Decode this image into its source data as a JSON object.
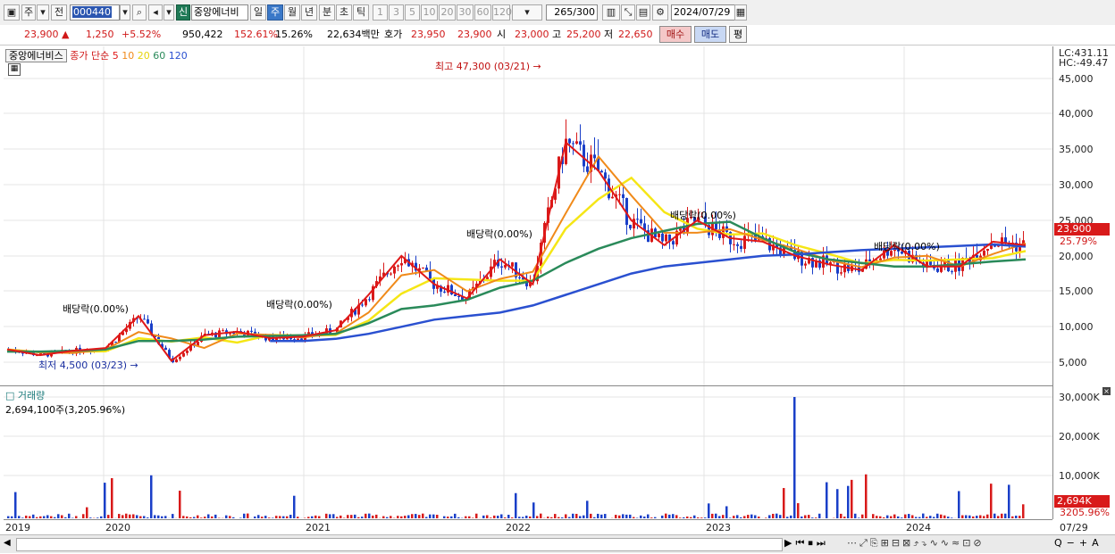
{
  "toolbar": {
    "period_type": "주",
    "prev_label": "전",
    "stock_code": "000440",
    "new_badge": "신",
    "stock_name": "중앙에너비",
    "periods": [
      "일",
      "주",
      "월",
      "년",
      "분",
      "초",
      "틱"
    ],
    "selected_period": "주",
    "minute_steps": [
      "1",
      "3",
      "5",
      "10",
      "20",
      "30",
      "60",
      "120"
    ],
    "count": "265",
    "count_total": "/300",
    "date": "2024/07/29"
  },
  "quote": {
    "price": "23,900",
    "change_arrow": "▲",
    "change": "1,250",
    "change_pct": "+5.52%",
    "volume": "950,422",
    "vol_ratio": "152.61%",
    "turnover": "15.26%",
    "amount": "22,634백만",
    "bid_ask_label": "호가",
    "ask": "23,950",
    "bid": "23,900",
    "open_label": "시",
    "open": "23,000",
    "high_label": "고",
    "high": "25,200",
    "low_label": "저",
    "low": "22,650",
    "buy_label": "매수",
    "sell_label": "매도",
    "eval_label": "평"
  },
  "legend": {
    "stock": "중앙에너비스",
    "close_label": "종가 단순",
    "ma": [
      {
        "label": "5",
        "color": "#e01818"
      },
      {
        "label": "10",
        "color": "#f08a1a"
      },
      {
        "label": "20",
        "color": "#f5e616"
      },
      {
        "label": "60",
        "color": "#2a8a5a"
      },
      {
        "label": "120",
        "color": "#2a50d0"
      }
    ]
  },
  "annotations": {
    "high": "최고 47,300 (03/21)",
    "low": "최저 4,500 (03/23)",
    "dividends": [
      "배당락(0.00%)",
      "배당락(0.00%)",
      "배당락(0.00%)",
      "배당락(0.00%)",
      "배당락(0.00%)"
    ]
  },
  "right_panel": {
    "lc": "LC:431.11",
    "hc": "HC:-49.47",
    "price_tag": "23,900",
    "pct_tag": "25.79%",
    "vol_tag": "2,694K",
    "vol_pct_tag": "3205.96%",
    "price_ticks": [
      "45,000",
      "40,000",
      "35,000",
      "30,000",
      "25,000",
      "20,000",
      "15,000",
      "10,000",
      "5,000"
    ],
    "vol_ticks": [
      "30,000K",
      "20,000K",
      "10,000K"
    ]
  },
  "volume": {
    "title": "거래량",
    "value": "2,694,100주(3,205.96%)"
  },
  "x_labels": [
    "2019",
    "2020",
    "2021",
    "2022",
    "2023",
    "2024",
    "07/29"
  ],
  "colors": {
    "up": "#d81a1a",
    "down": "#1a3fc8",
    "ma5": "#e01818",
    "ma10": "#f08a1a",
    "ma20": "#f5e616",
    "ma60": "#2a8a5a",
    "ma120": "#2a50d0"
  },
  "chart_data": {
    "type": "line",
    "title": "중앙에너비스",
    "xlabel": "",
    "ylabel": "",
    "ylim": [
      3500,
      48000
    ],
    "x": [
      "2019-01",
      "2019-04",
      "2019-07",
      "2019-10",
      "2020-01",
      "2020-03",
      "2020-05",
      "2020-08",
      "2020-11",
      "2021-01",
      "2021-03",
      "2021-05",
      "2021-06",
      "2021-08",
      "2021-10",
      "2021-11",
      "2022-01",
      "2022-03",
      "2022-04",
      "2022-06",
      "2022-08",
      "2022-10",
      "2022-12",
      "2023-02",
      "2023-04",
      "2023-07",
      "2023-09",
      "2023-11",
      "2024-01",
      "2024-03",
      "2024-05",
      "2024-07"
    ],
    "series": [
      {
        "name": "5",
        "values": [
          6800,
          6000,
          6600,
          7000,
          11500,
          5200,
          8800,
          9300,
          8400,
          8600,
          9500,
          14500,
          20000,
          16000,
          14000,
          19500,
          16000,
          36000,
          32000,
          25000,
          21500,
          25000,
          22500,
          22000,
          20000,
          18800,
          18000,
          21500,
          18500,
          18500,
          22000,
          21500
        ]
      },
      {
        "name": "60",
        "values": [
          6500,
          6500,
          6600,
          6800,
          8000,
          8000,
          8200,
          8600,
          8700,
          8800,
          9000,
          10500,
          12500,
          13000,
          13800,
          15500,
          16500,
          19000,
          21000,
          22500,
          23500,
          24500,
          24800,
          22500,
          20500,
          19500,
          19000,
          18500,
          18500,
          18800,
          19200,
          19500
        ]
      },
      {
        "name": "120",
        "values": [
          null,
          null,
          null,
          null,
          null,
          null,
          null,
          null,
          8000,
          8000,
          8300,
          9000,
          10000,
          11000,
          11500,
          12000,
          13000,
          14500,
          16000,
          17500,
          18500,
          19000,
          19500,
          20000,
          20200,
          20500,
          20800,
          21000,
          21200,
          21400,
          21600,
          21300
        ]
      }
    ],
    "volume_max": 30000
  }
}
